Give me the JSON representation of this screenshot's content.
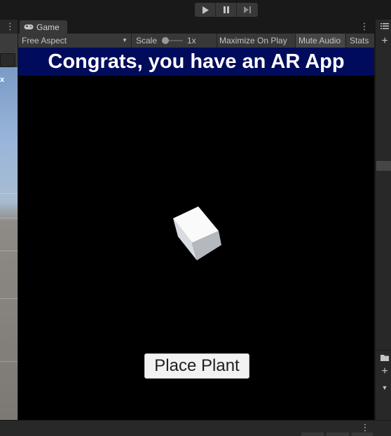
{
  "window": {
    "game_tab_label": "Game",
    "menu_glyph": "⋮"
  },
  "toolbar": {
    "play_icon": "play-icon",
    "pause_icon": "pause-icon",
    "step_icon": "step-icon"
  },
  "game_controls": {
    "aspect": "Free Aspect",
    "scale_label": "Scale",
    "scale_value": "1x",
    "maximize_label": "Maximize On Play",
    "mute_label": "Mute Audio",
    "stats_label": "Stats"
  },
  "game_view": {
    "banner_text": "Congrats, you have an AR App",
    "button_label": "Place Plant",
    "banner_color": "#000b5c"
  },
  "scene_panel": {
    "label_fragment": "x"
  },
  "colors": {
    "editor_bg": "#191919",
    "panel_bg": "#282828",
    "toolbar_btn": "#383838"
  }
}
